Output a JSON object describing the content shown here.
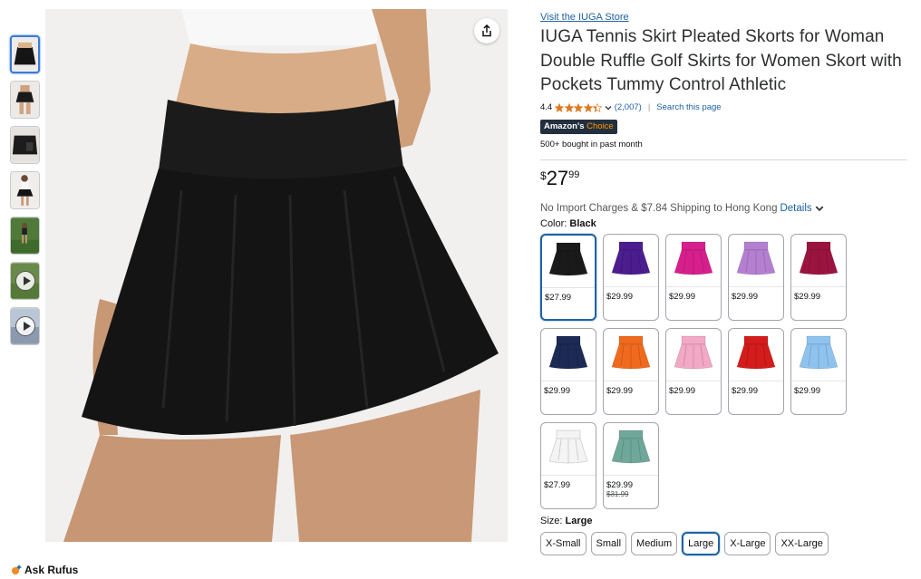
{
  "store_link": "Visit the IUGA Store",
  "title": "IUGA Tennis Skirt Pleated Skorts for Woman Double Ruffle Golf Skirts for Women Skort with Pockets Tummy Control Athletic",
  "rating": {
    "value": "4.4",
    "stars": 4.4,
    "count": "(2,007)",
    "search": "Search this page"
  },
  "badge": {
    "main": "Amazon's",
    "accent": "Choice"
  },
  "bought": "500+ bought in past month",
  "price": {
    "symbol": "$",
    "whole": "27",
    "fraction": "99"
  },
  "shipping": {
    "text": "No Import Charges & $7.84 Shipping to Hong Kong",
    "details": "Details"
  },
  "color": {
    "label": "Color:",
    "selected": "Black",
    "options": [
      {
        "name": "Black",
        "price": "$27.99",
        "color": "#1a1a1a"
      },
      {
        "name": "Purple",
        "price": "$29.99",
        "color": "#4b1d8f"
      },
      {
        "name": "Hot Pink",
        "price": "$29.99",
        "color": "#d61f8c"
      },
      {
        "name": "Lavender",
        "price": "$29.99",
        "color": "#b47fd1"
      },
      {
        "name": "Wine",
        "price": "$29.99",
        "color": "#9b1440"
      },
      {
        "name": "Navy",
        "price": "$29.99",
        "color": "#1c2a55"
      },
      {
        "name": "Orange",
        "price": "$29.99",
        "color": "#f06a1e"
      },
      {
        "name": "Pink",
        "price": "$29.99",
        "color": "#f3a8c5"
      },
      {
        "name": "Red",
        "price": "$29.99",
        "color": "#d41c1c"
      },
      {
        "name": "Light Blue",
        "price": "$29.99",
        "color": "#8fc3ef"
      },
      {
        "name": "White",
        "price": "$27.99",
        "color": "#f4f4f4"
      },
      {
        "name": "Sage",
        "price": "$29.99",
        "old_price": "$31.99",
        "color": "#6fa89a"
      }
    ]
  },
  "size": {
    "label": "Size:",
    "selected": "Large",
    "options": [
      "X-Small",
      "Small",
      "Medium",
      "Large",
      "X-Large",
      "XX-Large"
    ]
  },
  "rufus": "Ask Rufus"
}
